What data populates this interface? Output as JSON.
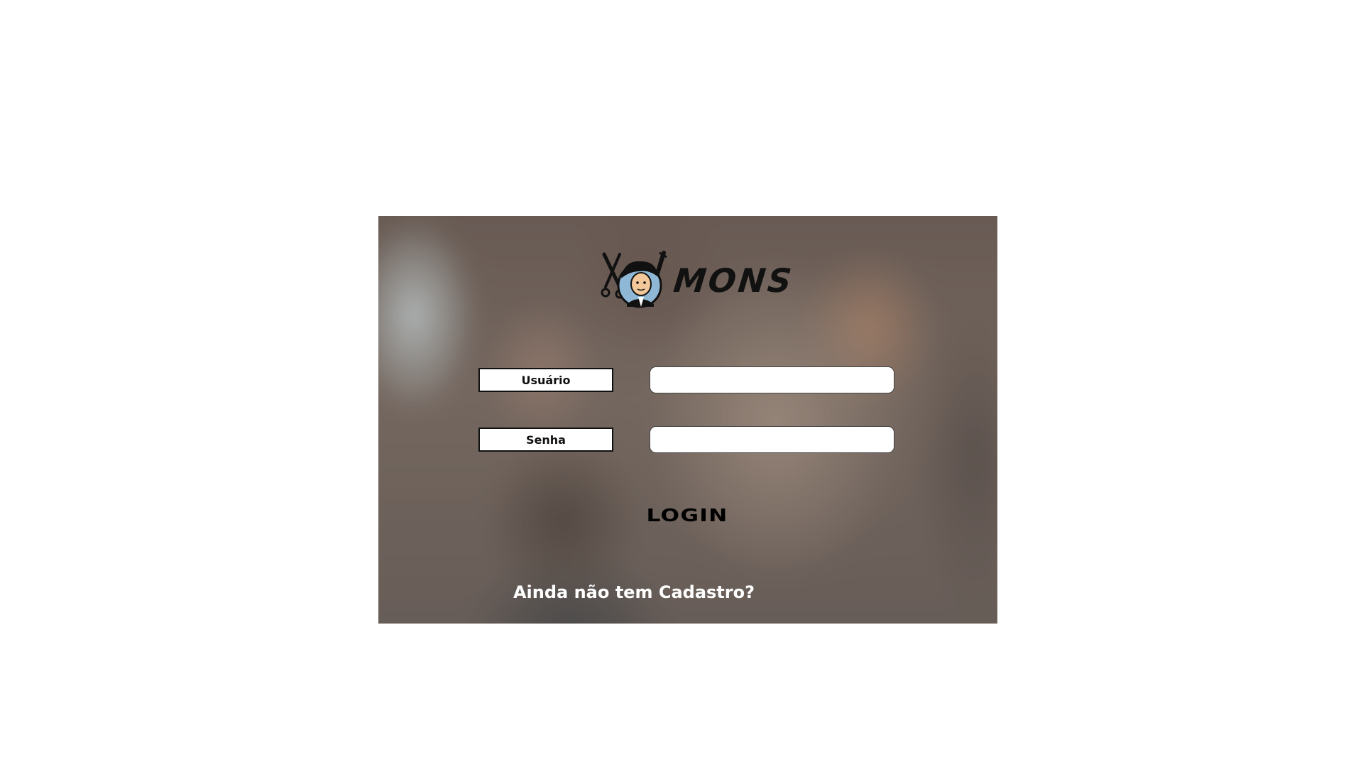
{
  "logo": {
    "text": "MONS"
  },
  "form": {
    "username_label": "Usuário",
    "username_value": "",
    "password_label": "Senha",
    "password_value": ""
  },
  "login_button": {
    "label": "LOGIN"
  },
  "signup_link": {
    "text": "Ainda não tem Cadastro?"
  }
}
